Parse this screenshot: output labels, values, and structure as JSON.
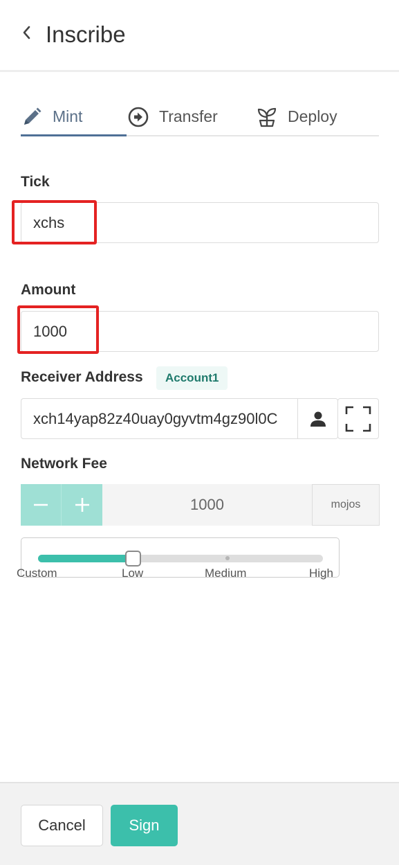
{
  "header": {
    "title": "Inscribe",
    "back_icon": "chevron-left-icon"
  },
  "tabs": [
    {
      "label": "Mint",
      "icon": "pencil-icon",
      "active": true
    },
    {
      "label": "Transfer",
      "icon": "arrow-right-circle-icon",
      "active": false
    },
    {
      "label": "Deploy",
      "icon": "sprout-icon",
      "active": false
    }
  ],
  "form": {
    "tick": {
      "label": "Tick",
      "value": "xchs"
    },
    "amount": {
      "label": "Amount",
      "value": "1000"
    },
    "receiver": {
      "label": "Receiver Address",
      "account_badge": "Account1",
      "value": "xch14yap82z40uay0gyvtm4gz90l0C",
      "contact_icon": "person-icon",
      "scan_icon": "scan-icon"
    },
    "network_fee": {
      "label": "Network Fee",
      "value": "1000",
      "unit": "mojos",
      "minus_icon": "minus-icon",
      "plus_icon": "plus-icon"
    },
    "fee_slider": {
      "marks": [
        "Custom",
        "Low",
        "Medium",
        "High"
      ],
      "selected": "Low",
      "position_fraction": 0.333
    }
  },
  "footer": {
    "cancel_label": "Cancel",
    "sign_label": "Sign"
  },
  "colors": {
    "accent": "#3cbfab",
    "accent_light": "#9fe0d5",
    "tab_active": "#4f7096",
    "highlight": "#e42222",
    "badge_text": "#1f7a6c"
  }
}
